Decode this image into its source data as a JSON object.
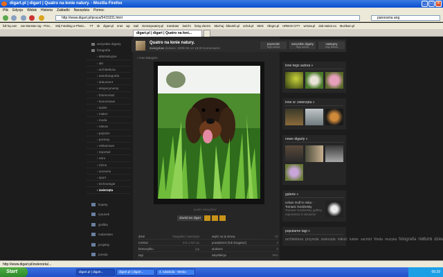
{
  "window": {
    "title": "digart.pl | digart | Quatro na łonie natury. - Mozilla Firefox"
  },
  "menu": [
    "Plik",
    "Edycja",
    "Widok",
    "Historia",
    "Zakładki",
    "Narzędzia",
    "Pomoc"
  ],
  "url": "http://www.digart.pl/praca/5415331.html",
  "search_value": "panorama ang",
  "bookmarks": [
    "full-hq.com",
    "Joe Monster.org - Prze...",
    "Mój Fotoblog w Photo...",
    "YT",
    "nk",
    "digart.pl",
    "enet",
    "wp",
    "mail",
    "Demotywatory.pl",
    "translator",
    "last.fm",
    "living electro",
    "Słuchaj - bibaInfo.pl",
    "uClub.pl",
    "Wiek",
    "Allegro.pl",
    "URBAN CITY",
    "wrzuta.pl",
    "dub-nation.eu",
    "Muzikum.pl"
  ],
  "tabs": [
    "digart.pl | digart | Quatro na łoni...",
    ""
  ],
  "sidebar": {
    "top": [
      {
        "label": "wszystkie digarty"
      },
      {
        "label": "fotografia"
      }
    ],
    "sub": [
      "abstrakcyjne",
      "akt",
      "architektura",
      "astrofotografia",
      "dokument",
      "eksperymenty",
      "fotomontaż",
      "koncertowe",
      "ludzie",
      "makro",
      "moda",
      "natura",
      "pejzaże",
      "portrety",
      "reklamowe",
      "reportaż",
      "retro",
      "różne",
      "scenerie",
      "sport",
      "technologie",
      "zwierzęta"
    ],
    "categories": [
      "kopety",
      "rysunek",
      "grafika",
      "malarstwo",
      "projekty",
      "poezja",
      "proza"
    ]
  },
  "work": {
    "title": "Quatro na łonie natury.",
    "author": "swiegolaw",
    "stats": "dodano: 2008-05-14 16:00 komentarze",
    "prev": "poprzedni",
    "prev_sub": "tego autora",
    "all": "wszystkie digarty",
    "all_sub": "tego autora",
    "next": "następny",
    "next_sub": "tego autora",
    "breadcrumb": "« inne kategorie",
    "caption": "quatro swiegolaw",
    "action": "obwód ten digart"
  },
  "info_left": [
    {
      "k": "dział",
      "v": "fotografia / zwierzęta"
    },
    {
      "k": "rozmiar",
      "v": "471 x 627 px"
    },
    {
      "k": "format pliku",
      "v": "jpg"
    },
    {
      "k": "tagi",
      "v": ""
    }
  ],
  "info_right": [
    {
      "k": "wejść na tę stronę",
      "v": "57"
    },
    {
      "k": "powiększeń (lub ściągnięć)",
      "v": "3"
    },
    {
      "k": "ulubione",
      "v": "0"
    },
    {
      "k": "satysfakcja",
      "v": "96%"
    }
  ],
  "right": {
    "more_author": "inne tego autora »",
    "more_category": "inne w: zwierzęta »",
    "new": "nowe digarty »",
    "gallery_head": "galerie »",
    "gallery_text": "Urban Gulf in mika - Tomasz Godziesky",
    "gallery_sub": "Tomasz Godziesky gallery",
    "gallery_sub2": "najnowsza 3 obrazów",
    "tags_head": "popularne tagi »",
    "tags": [
      "architektura",
      "przyroda",
      "zwierzęta",
      "miłość",
      "ludzie",
      "zachód",
      "Woda",
      "muzyka",
      "fotografia",
      "natura",
      "dziewczyna",
      "słońce",
      "zima",
      "Kwiat"
    ]
  },
  "status": "http://www.digart.pl/zwierzeta/...",
  "taskbar": {
    "start": "Start",
    "tasks": [
      "digart.pl | digart...",
      "digart.pl | digart...",
      "4. tulatinda - Mesia"
    ],
    "clock": "06:29"
  }
}
